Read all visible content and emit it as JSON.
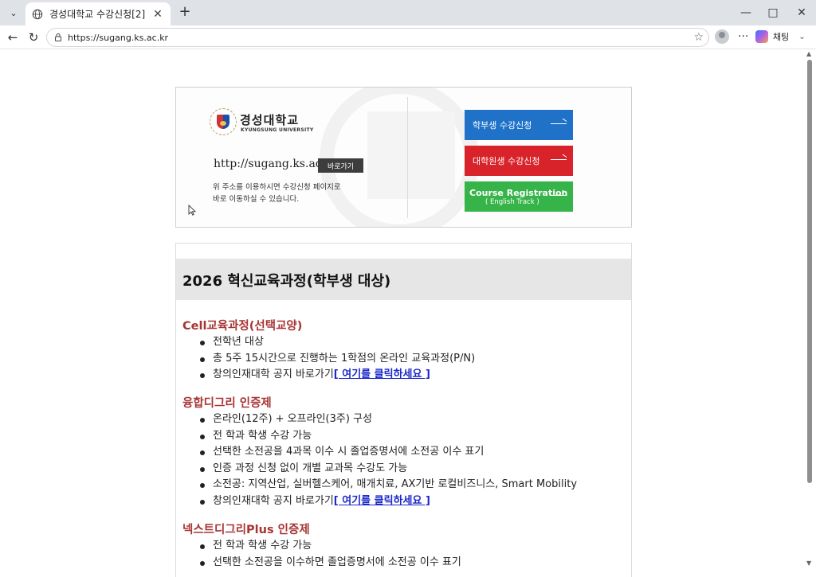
{
  "browser": {
    "tab_title": "경성대학교 수강신청[2]",
    "url": "https://sugang.ks.ac.kr",
    "copilot_label": "채팅"
  },
  "banner": {
    "logo_kr": "경성대학교",
    "logo_en": "KYUNGSUNG UNIVERSITY",
    "site_url": "http://sugang.ks.ac.kr",
    "goto_label": "바로가기",
    "desc_line1": "위 주소를 이용하시면 수강신청 페이지로",
    "desc_line2": "바로 이동하실 수 있습니다.",
    "btn_undergrad": "학부생 수강신청",
    "btn_grad": "대학원생 수강신청",
    "btn_english_l1": "Course Registration",
    "btn_english_l2": "( English Track )"
  },
  "content": {
    "title": "2026 혁신교육과정(학부생 대상)",
    "sections": [
      {
        "heading": "Cell교육과정(선택교양)",
        "items": [
          "전학년 대상",
          "총 5주 15시간으로 진행하는 1학점의 온라인 교육과정(P/N)",
          "창의인재대학 공지 바로가기"
        ],
        "link": "[ 여기를 클릭하세요 ]"
      },
      {
        "heading": "융합디그리 인증제",
        "items": [
          "온라인(12주) + 오프라인(3주) 구성",
          "전 학과 학생 수강 가능",
          "선택한 소전공을 4과목 이수 시 졸업증명서에 소전공 이수 표기",
          "인증 과정 신청 없이 개별 교과목 수강도 가능",
          "소전공: 지역산업, 실버헬스케어, 매개치료, AX기반 로컬비즈니스, Smart Mobility",
          "창의인재대학 공지 바로가기"
        ],
        "link": "[ 여기를 클릭하세요 ]"
      },
      {
        "heading": "넥스트디그리Plus 인증제",
        "items": [
          "전 학과 학생 수강 가능",
          "선택한 소전공을 이수하면 졸업증명서에 소전공 이수 표기"
        ]
      }
    ]
  },
  "colors": {
    "undergrad": "#1f72c8",
    "grad": "#d8232a",
    "english": "#36b44a",
    "section_heading": "#a83434",
    "link": "#1a27c9"
  }
}
